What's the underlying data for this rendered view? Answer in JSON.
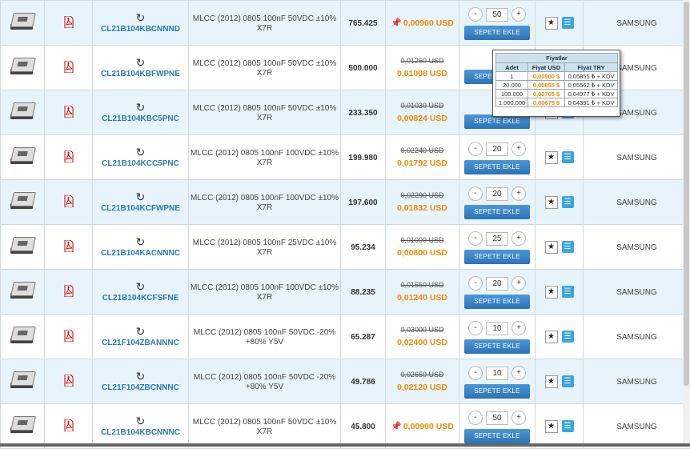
{
  "add_to_cart_label": "SEPETE EKLE",
  "rows": [
    {
      "code": "CL21B104KBCNNND",
      "desc": "MLCC (2012) 0805 100nF 50VDC ±10% X7R",
      "stock": "765.425",
      "old_price": "",
      "price": "0,00900 USD",
      "pinned": true,
      "qty": "50",
      "brand": "SAMSUNG",
      "alt": true
    },
    {
      "code": "CL21B104KBFWPNE",
      "desc": "MLCC (2012) 0805 100nF 50VDC ±10% X7R",
      "stock": "500.000",
      "old_price": "0,01260 USD",
      "price": "0,01008 USD",
      "pinned": false,
      "qty": "",
      "brand": "SAMSUNG",
      "alt": false
    },
    {
      "code": "CL21B104KBC5PNC",
      "desc": "MLCC (2012) 0805 100nF 50VDC ±10% X7R",
      "stock": "233.350",
      "old_price": "0,01030 USD",
      "price": "0,00824 USD",
      "pinned": false,
      "qty": "",
      "brand": "SAMSUNG",
      "alt": true
    },
    {
      "code": "CL21B104KCC5PNC",
      "desc": "MLCC (2012) 0805 100nF 100VDC ±10% X7R",
      "stock": "199.980",
      "old_price": "0,02240 USD",
      "price": "0,01792 USD",
      "pinned": false,
      "qty": "20",
      "brand": "SAMSUNG",
      "alt": false
    },
    {
      "code": "CL21B104KCFWPNE",
      "desc": "MLCC (2012) 0805 100nF 100VDC ±10% X7R",
      "stock": "197.600",
      "old_price": "0,02290 USD",
      "price": "0,01832 USD",
      "pinned": false,
      "qty": "20",
      "brand": "SAMSUNG",
      "alt": true
    },
    {
      "code": "CL21B104KACNNNC",
      "desc": "MLCC (2012) 0805 100nF 25VDC ±10% X7R",
      "stock": "95.234",
      "old_price": "0,01000 USD",
      "price": "0,00800 USD",
      "pinned": false,
      "qty": "25",
      "brand": "SAMSUNG",
      "alt": false
    },
    {
      "code": "CL21B104KCFSFNE",
      "desc": "MLCC (2012) 0805 100nF 100VDC ±10% X7R",
      "stock": "88.235",
      "old_price": "0,01550 USD",
      "price": "0,01240 USD",
      "pinned": false,
      "qty": "20",
      "brand": "SAMSUNG",
      "alt": true
    },
    {
      "code": "CL21F104ZBANNNC",
      "desc": "MLCC (2012) 0805 100nF 50VDC -20% +80% Y5V",
      "stock": "65.287",
      "old_price": "0,03000 USD",
      "price": "0,02400 USD",
      "pinned": false,
      "qty": "10",
      "brand": "SAMSUNG",
      "alt": false
    },
    {
      "code": "CL21F104ZBCNNNC",
      "desc": "MLCC (2012) 0805 100nF 50VDC -20% +80% Y5V",
      "stock": "49.786",
      "old_price": "0,02650 USD",
      "price": "0,02120 USD",
      "pinned": false,
      "qty": "10",
      "brand": "SAMSUNG",
      "alt": true
    },
    {
      "code": "CL21B104KBCNNNC",
      "desc": "MLCC (2012) 0805 100nF 50VDC ±10% X7R",
      "stock": "45.800",
      "old_price": "",
      "price": "0,00900 USD",
      "pinned": true,
      "qty": "50",
      "brand": "SAMSUNG",
      "alt": false
    }
  ],
  "price_popup": {
    "title": "Fiyatlar",
    "headers": [
      "Adet",
      "Fiyat USD",
      "Fiyat TRY"
    ],
    "rows": [
      {
        "adet": "1",
        "usd": "0,00900 $",
        "try": "0,05855 ₺ + KDV"
      },
      {
        "adet": "20.000",
        "usd": "0,00855 $",
        "try": "0,05562 ₺ + KDV"
      },
      {
        "adet": "100.000",
        "usd": "0,00765 $",
        "try": "0,04977 ₺ + KDV"
      },
      {
        "adet": "1.000.000",
        "usd": "0,00675 $",
        "try": "0,04391 ₺ + KDV"
      }
    ]
  },
  "colors": {
    "accent": "#2a7ab7",
    "price": "#f08a00",
    "row_alt": "#e8f4fc",
    "button": "#2b73b6"
  }
}
